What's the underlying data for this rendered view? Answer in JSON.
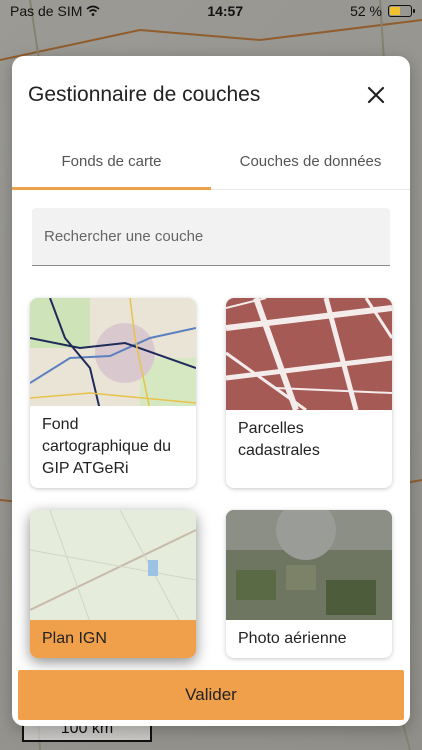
{
  "status_bar": {
    "carrier": "Pas de SIM",
    "time": "14:57",
    "battery": "52 %",
    "battery_level": 0.52
  },
  "map": {
    "scale_label": "100 km"
  },
  "modal": {
    "title": "Gestionnaire de couches",
    "tabs": [
      {
        "label": "Fonds de carte",
        "active": true
      },
      {
        "label": "Couches de données",
        "active": false
      }
    ],
    "search": {
      "placeholder": "Rechercher une couche",
      "value": ""
    },
    "layers": [
      {
        "label": "Fond cartographique du GIP ATGeRi",
        "selected": false
      },
      {
        "label": "Parcelles cadastrales",
        "selected": false
      },
      {
        "label": "Plan IGN",
        "selected": true
      },
      {
        "label": "Photo aérienne",
        "selected": false
      }
    ],
    "validate_label": "Valider"
  },
  "colors": {
    "accent": "#f0a04b",
    "cadastre": "#a65a55"
  }
}
